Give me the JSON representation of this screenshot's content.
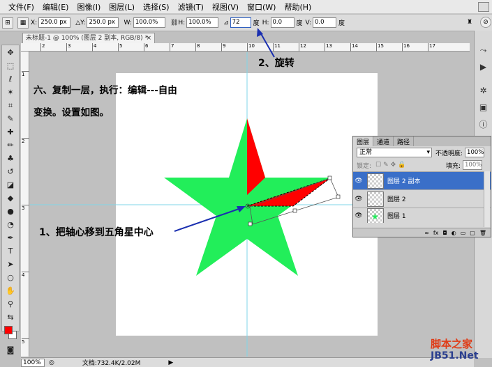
{
  "menu": [
    "文件(F)",
    "编辑(E)",
    "图像(I)",
    "图层(L)",
    "选择(S)",
    "滤镜(T)",
    "视图(V)",
    "窗口(W)",
    "帮助(H)"
  ],
  "options": {
    "x_label": "X:",
    "x_value": "250.0 px",
    "y_label": "Y:",
    "y_value": "250.0 px",
    "w_label": "W:",
    "w_value": "100.0%",
    "h_label": "H:",
    "h_value": "100.0%",
    "angle_value": "72",
    "angle_unit": "度",
    "hskew_label": "H:",
    "hskew_value": "0.0",
    "hskew_unit": "度",
    "vskew_label": "V:",
    "vskew_value": "0.0",
    "vskew_unit": "度"
  },
  "document": {
    "tab_title": "未标题-1 @ 100% (图层 2 副本, RGB/8) *",
    "close": "×"
  },
  "ruler": {
    "top_ticks": [
      "2",
      "3",
      "4",
      "5",
      "6",
      "7",
      "8",
      "9",
      "10",
      "11",
      "12",
      "13",
      "14",
      "15",
      "16",
      "17"
    ],
    "left_ticks": [
      "1",
      "2",
      "3",
      "4",
      "5"
    ]
  },
  "annotations": {
    "step_line1": "六、复制一层，执行：编辑---自由",
    "step_line2": "变换。设置如图。",
    "rotate": "2、旋转",
    "pivot": "1、把轴心移到五角星中心"
  },
  "layers_panel": {
    "tabs": [
      "图层",
      "通道",
      "路径"
    ],
    "blend_mode": "正常",
    "opacity_label": "不透明度:",
    "opacity_value": "100%",
    "lock_label": "锁定:",
    "fill_label": "填充:",
    "fill_value": "100%",
    "layers": [
      {
        "name": "图层 2 副本",
        "active": true
      },
      {
        "name": "图层 2",
        "active": false
      },
      {
        "name": "图层 1",
        "active": false
      }
    ]
  },
  "status": {
    "zoom": "100%",
    "doc_info": "文档:732.4K/2.02M"
  },
  "watermark": {
    "line1": "脚本之家",
    "line2": "JB51.Net"
  },
  "colors": {
    "star_green": "#22ee5a",
    "star_red": "#ff0000",
    "arrow_blue": "#1a2fb0",
    "layer_active": "#3a6fc8"
  }
}
